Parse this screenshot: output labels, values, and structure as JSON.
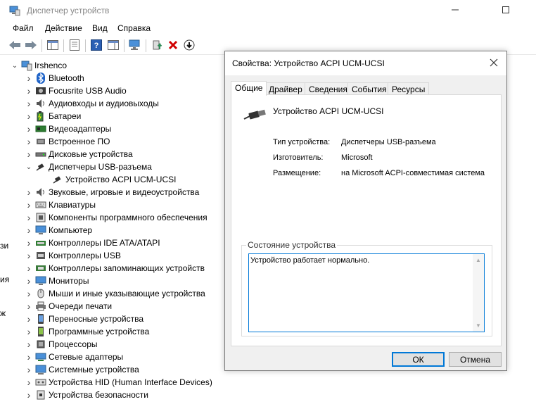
{
  "window": {
    "title": "Диспетчер устройств"
  },
  "menu": [
    "Файл",
    "Действие",
    "Вид",
    "Справка"
  ],
  "tree": {
    "root": "Irshenco",
    "items": [
      {
        "label": "Bluetooth",
        "icon": "bluetooth-icon",
        "expanded": false
      },
      {
        "label": "Focusrite USB Audio",
        "icon": "audio-device-icon",
        "expanded": false
      },
      {
        "label": "Аудиовходы и аудиовыходы",
        "icon": "speaker-icon",
        "expanded": false
      },
      {
        "label": "Батареи",
        "icon": "battery-icon",
        "expanded": false
      },
      {
        "label": "Видеоадаптеры",
        "icon": "display-adapter-icon",
        "expanded": false
      },
      {
        "label": "Встроенное ПО",
        "icon": "firmware-icon",
        "expanded": false
      },
      {
        "label": "Дисковые устройства",
        "icon": "disk-drive-icon",
        "expanded": false
      },
      {
        "label": "Диспетчеры USB-разъема",
        "icon": "usb-connector-icon",
        "expanded": true
      },
      {
        "label": "Устройство ACPI UCM-UCSI",
        "icon": "usb-connector-icon",
        "child": true
      },
      {
        "label": "Звуковые, игровые и видеоустройства",
        "icon": "speaker-icon",
        "expanded": false
      },
      {
        "label": "Клавиатуры",
        "icon": "keyboard-icon",
        "expanded": false
      },
      {
        "label": "Компоненты программного обеспечения",
        "icon": "software-component-icon",
        "expanded": false
      },
      {
        "label": "Компьютер",
        "icon": "computer-icon",
        "expanded": false
      },
      {
        "label": "Контроллеры IDE ATA/ATAPI",
        "icon": "ide-controller-icon",
        "expanded": false
      },
      {
        "label": "Контроллеры USB",
        "icon": "usb-controller-icon",
        "expanded": false
      },
      {
        "label": "Контроллеры запоминающих устройств",
        "icon": "storage-controller-icon",
        "expanded": false
      },
      {
        "label": "Мониторы",
        "icon": "monitor-icon",
        "expanded": false
      },
      {
        "label": "Мыши и иные указывающие устройства",
        "icon": "mouse-icon",
        "expanded": false
      },
      {
        "label": "Очереди печати",
        "icon": "printer-icon",
        "expanded": false
      },
      {
        "label": "Переносные устройства",
        "icon": "portable-device-icon",
        "expanded": false
      },
      {
        "label": "Программные устройства",
        "icon": "software-device-icon",
        "expanded": false
      },
      {
        "label": "Процессоры",
        "icon": "processor-icon",
        "expanded": false
      },
      {
        "label": "Сетевые адаптеры",
        "icon": "network-adapter-icon",
        "expanded": false
      },
      {
        "label": "Системные устройства",
        "icon": "system-device-icon",
        "expanded": false
      },
      {
        "label": "Устройства HID (Human Interface Devices)",
        "icon": "hid-icon",
        "expanded": false
      },
      {
        "label": "Устройства безопасности",
        "icon": "security-device-icon",
        "expanded": false
      }
    ]
  },
  "edge_letters": [
    "зи",
    "ия",
    "ж"
  ],
  "dialog": {
    "title": "Свойства: Устройство ACPI UCM-UCSI",
    "tabs": [
      "Общие",
      "Драйвер",
      "Сведения",
      "События",
      "Ресурсы"
    ],
    "active_tab": 0,
    "device_name": "Устройство ACPI UCM-UCSI",
    "properties": [
      {
        "label": "Тип устройства:",
        "value": "Диспетчеры USB-разъема"
      },
      {
        "label": "Изготовитель:",
        "value": "Microsoft"
      },
      {
        "label": "Размещение:",
        "value": "на Microsoft ACPI-совместимая система"
      }
    ],
    "status_group_label": "Состояние устройства",
    "status_text": "Устройство работает нормально.",
    "ok_label": "ОК",
    "cancel_label": "Отмена"
  },
  "colors": {
    "accent": "#0078d7",
    "dialog_bg": "#f0f0f0",
    "window_bg": "#ffffff",
    "remove_red": "#d00000",
    "update_green": "#2e8b57"
  }
}
